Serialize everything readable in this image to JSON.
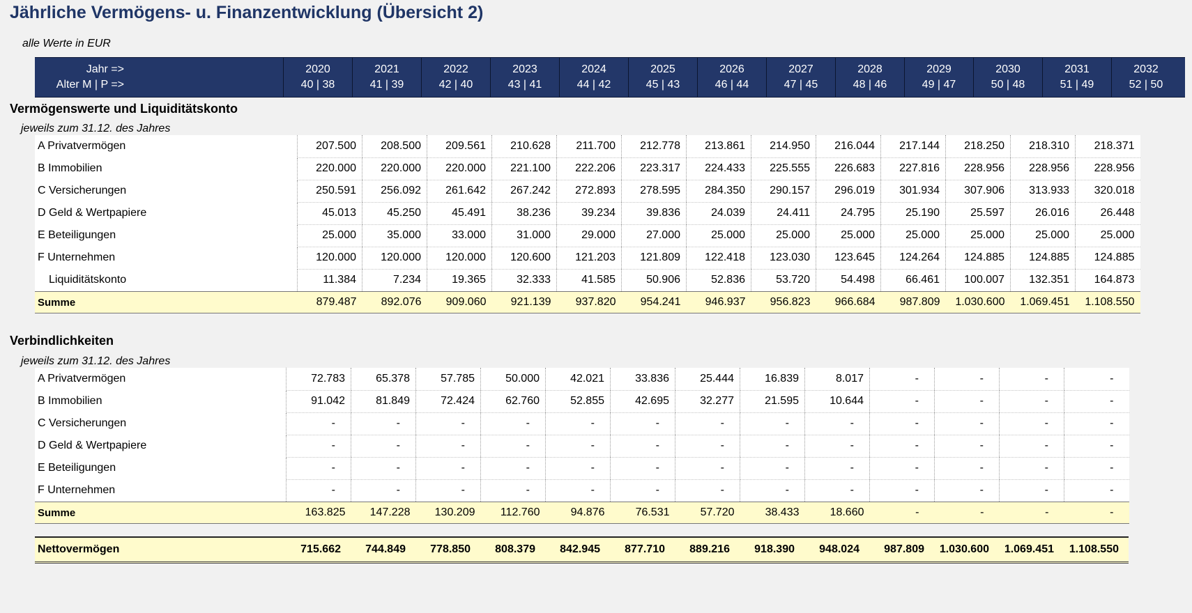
{
  "title": "Jährliche Vermögens- u. Finanzentwicklung (Übersicht 2)",
  "note": "alle Werte in EUR",
  "header": {
    "label_year": "Jahr =>",
    "label_age": "Alter M | P =>",
    "years": [
      "2020",
      "2021",
      "2022",
      "2023",
      "2024",
      "2025",
      "2026",
      "2027",
      "2028",
      "2029",
      "2030",
      "2031",
      "2032"
    ],
    "ages": [
      "40 | 38",
      "41 | 39",
      "42 | 40",
      "43 | 41",
      "44 | 42",
      "45 | 43",
      "46 | 44",
      "47 | 45",
      "48 | 46",
      "49 | 47",
      "50 | 48",
      "51 | 49",
      "52 | 50"
    ]
  },
  "assets": {
    "title": "Vermögenswerte und Liquiditätskonto",
    "subtitle": "jeweils zum 31.12. des Jahres",
    "rows": [
      {
        "label": "A Privatvermögen",
        "values": [
          "207.500",
          "208.500",
          "209.561",
          "210.628",
          "211.700",
          "212.778",
          "213.861",
          "214.950",
          "216.044",
          "217.144",
          "218.250",
          "218.310",
          "218.371"
        ]
      },
      {
        "label": "B Immobilien",
        "values": [
          "220.000",
          "220.000",
          "220.000",
          "221.100",
          "222.206",
          "223.317",
          "224.433",
          "225.555",
          "226.683",
          "227.816",
          "228.956",
          "228.956",
          "228.956"
        ]
      },
      {
        "label": "C Versicherungen",
        "values": [
          "250.591",
          "256.092",
          "261.642",
          "267.242",
          "272.893",
          "278.595",
          "284.350",
          "290.157",
          "296.019",
          "301.934",
          "307.906",
          "313.933",
          "320.018"
        ]
      },
      {
        "label": "D Geld & Wertpapiere",
        "values": [
          "45.013",
          "45.250",
          "45.491",
          "38.236",
          "39.234",
          "39.836",
          "24.039",
          "24.411",
          "24.795",
          "25.190",
          "25.597",
          "26.016",
          "26.448"
        ]
      },
      {
        "label": "E Beteiligungen",
        "values": [
          "25.000",
          "35.000",
          "33.000",
          "31.000",
          "29.000",
          "27.000",
          "25.000",
          "25.000",
          "25.000",
          "25.000",
          "25.000",
          "25.000",
          "25.000"
        ]
      },
      {
        "label": "F Unternehmen",
        "values": [
          "120.000",
          "120.000",
          "120.000",
          "120.600",
          "121.203",
          "121.809",
          "122.418",
          "123.030",
          "123.645",
          "124.264",
          "124.885",
          "124.885",
          "124.885"
        ]
      },
      {
        "label": "Liquiditätskonto",
        "values": [
          "11.384",
          "7.234",
          "19.365",
          "32.333",
          "41.585",
          "50.906",
          "52.836",
          "53.720",
          "54.498",
          "66.461",
          "100.007",
          "132.351",
          "164.873"
        ]
      }
    ],
    "sum": {
      "label": "Summe",
      "values": [
        "879.487",
        "892.076",
        "909.060",
        "921.139",
        "937.820",
        "954.241",
        "946.937",
        "956.823",
        "966.684",
        "987.809",
        "1.030.600",
        "1.069.451",
        "1.108.550"
      ]
    }
  },
  "liabilities": {
    "title": "Verbindlichkeiten",
    "subtitle": "jeweils zum 31.12. des Jahres",
    "rows": [
      {
        "label": "A Privatvermögen",
        "values": [
          "72.783",
          "65.378",
          "57.785",
          "50.000",
          "42.021",
          "33.836",
          "25.444",
          "16.839",
          "8.017",
          "-",
          "-",
          "-",
          "-"
        ]
      },
      {
        "label": "B Immobilien",
        "values": [
          "91.042",
          "81.849",
          "72.424",
          "62.760",
          "52.855",
          "42.695",
          "32.277",
          "21.595",
          "10.644",
          "-",
          "-",
          "-",
          "-"
        ]
      },
      {
        "label": "C Versicherungen",
        "values": [
          "-",
          "-",
          "-",
          "-",
          "-",
          "-",
          "-",
          "-",
          "-",
          "-",
          "-",
          "-",
          "-"
        ]
      },
      {
        "label": "D Geld & Wertpapiere",
        "values": [
          "-",
          "-",
          "-",
          "-",
          "-",
          "-",
          "-",
          "-",
          "-",
          "-",
          "-",
          "-",
          "-"
        ]
      },
      {
        "label": "E Beteiligungen",
        "values": [
          "-",
          "-",
          "-",
          "-",
          "-",
          "-",
          "-",
          "-",
          "-",
          "-",
          "-",
          "-",
          "-"
        ]
      },
      {
        "label": "F Unternehmen",
        "values": [
          "-",
          "-",
          "-",
          "-",
          "-",
          "-",
          "-",
          "-",
          "-",
          "-",
          "-",
          "-",
          "-"
        ]
      }
    ],
    "sum": {
      "label": "Summe",
      "values": [
        "163.825",
        "147.228",
        "130.209",
        "112.760",
        "94.876",
        "76.531",
        "57.720",
        "38.433",
        "18.660",
        "-",
        "-",
        "-",
        "-"
      ]
    }
  },
  "net": {
    "label": "Nettovermögen",
    "values": [
      "715.662",
      "744.849",
      "778.850",
      "808.379",
      "842.945",
      "877.710",
      "889.216",
      "918.390",
      "948.024",
      "987.809",
      "1.030.600",
      "1.069.451",
      "1.108.550"
    ]
  }
}
